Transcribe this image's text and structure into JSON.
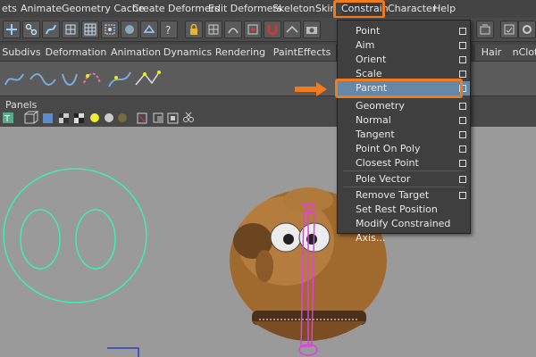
{
  "menubar": {
    "items": [
      "ets",
      "Animate",
      "Geometry Cache",
      "Create Deformers",
      "Edit Deformers",
      "Skeleton",
      "Skin",
      "Constrain",
      "Character",
      "Help"
    ],
    "active": "Constrain"
  },
  "shelf_tabs": [
    "Subdivs",
    "Deformation",
    "Animation",
    "Dynamics",
    "Rendering",
    "PaintEffects",
    "Hair",
    "nClot"
  ],
  "panels_label": "Panels",
  "constrain_menu": {
    "items": [
      {
        "label": "Point",
        "option_box": true,
        "highlighted": false
      },
      {
        "label": "Aim",
        "option_box": true,
        "highlighted": false
      },
      {
        "label": "Orient",
        "option_box": true,
        "highlighted": false
      },
      {
        "label": "Scale",
        "option_box": true,
        "highlighted": false
      },
      {
        "label": "Parent",
        "option_box": true,
        "highlighted": true
      },
      {
        "label": "Geometry",
        "option_box": true,
        "highlighted": false
      },
      {
        "label": "Normal",
        "option_box": true,
        "highlighted": false
      },
      {
        "label": "Tangent",
        "option_box": true,
        "highlighted": false
      },
      {
        "label": "Point On Poly",
        "option_box": true,
        "highlighted": false
      },
      {
        "label": "Closest Point",
        "option_box": true,
        "highlighted": false
      },
      {
        "label": "Pole Vector",
        "option_box": true,
        "highlighted": false
      },
      {
        "label": "Remove Target",
        "option_box": true,
        "highlighted": false
      },
      {
        "label": "Set Rest Position",
        "option_box": false,
        "highlighted": false
      },
      {
        "label": "Modify Constrained Axis...",
        "option_box": false,
        "highlighted": false
      }
    ]
  },
  "colors": {
    "highlight_outline": "#f07a1c",
    "menu_highlight": "#6688a8",
    "curve_control": "#3ef0b0",
    "joint": "#e040e0"
  },
  "icons": [
    "move-icon",
    "joint-tool-icon",
    "ik-handle-icon",
    "curve-icon",
    "lattice-icon",
    "cluster-icon",
    "sphere-icon",
    "help-icon",
    "lock-icon",
    "magnet-icon",
    "camera-icon",
    "render-icon",
    "ipr-icon",
    "settings-icon"
  ]
}
